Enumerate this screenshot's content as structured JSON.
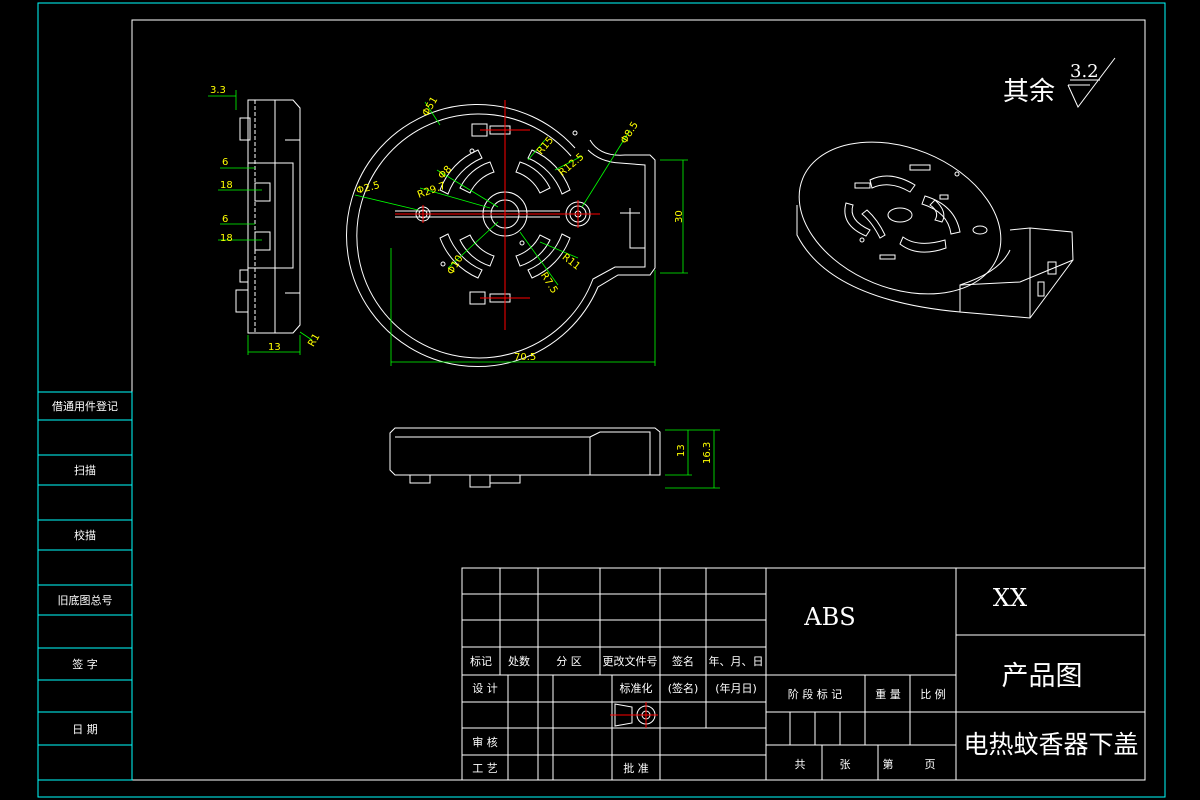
{
  "surface_finish": {
    "prefix": "其余",
    "roughness": "3.2"
  },
  "side_strip": [
    "借通用件登记",
    "扫描",
    "校描",
    "旧底图总号",
    "签 字",
    "日 期"
  ],
  "dims": {
    "left_top": "3.3",
    "left_6a": "6",
    "left_18a": "18",
    "left_6b": "6",
    "left_18b": "18",
    "left_bottom": "13",
    "left_r1": "R1",
    "front_width": "70.5",
    "front_height": "30",
    "front_d51": "Φ51",
    "front_r15": "R15",
    "front_d85": "Φ8.5",
    "front_d8": "Φ8",
    "front_r125": "R12.5",
    "front_r297": "R29.7",
    "front_d25": "Φ2.5",
    "front_d10": "Φ10",
    "front_r75": "R7.5",
    "front_r11": "R11",
    "bottom_13": "13",
    "bottom_163": "16.3"
  },
  "title_block": {
    "material": "ABS",
    "company": "XX",
    "drawing_type": "产品图",
    "part_name": "电热蚊香器下盖",
    "rev_headers": [
      "标记",
      "处数",
      "分 区",
      "更改文件号",
      "签名",
      "年、月、日"
    ],
    "design": "设 计",
    "standardize": "标准化",
    "signature": "(签名)",
    "date": "(年月日)",
    "review": "审 核",
    "process": "工 艺",
    "approve": "批 准",
    "stage_mark": "阶 段 标 记",
    "weight": "重 量",
    "scale": "比 例",
    "total": "共",
    "sheets": "张",
    "sheet_no": "第",
    "page": "页"
  },
  "colors": {
    "frame": "#00ffff",
    "outline": "#ffffff",
    "dimension": "#00ff00",
    "centerline": "#ff0000",
    "dim_text": "#ffff00"
  }
}
